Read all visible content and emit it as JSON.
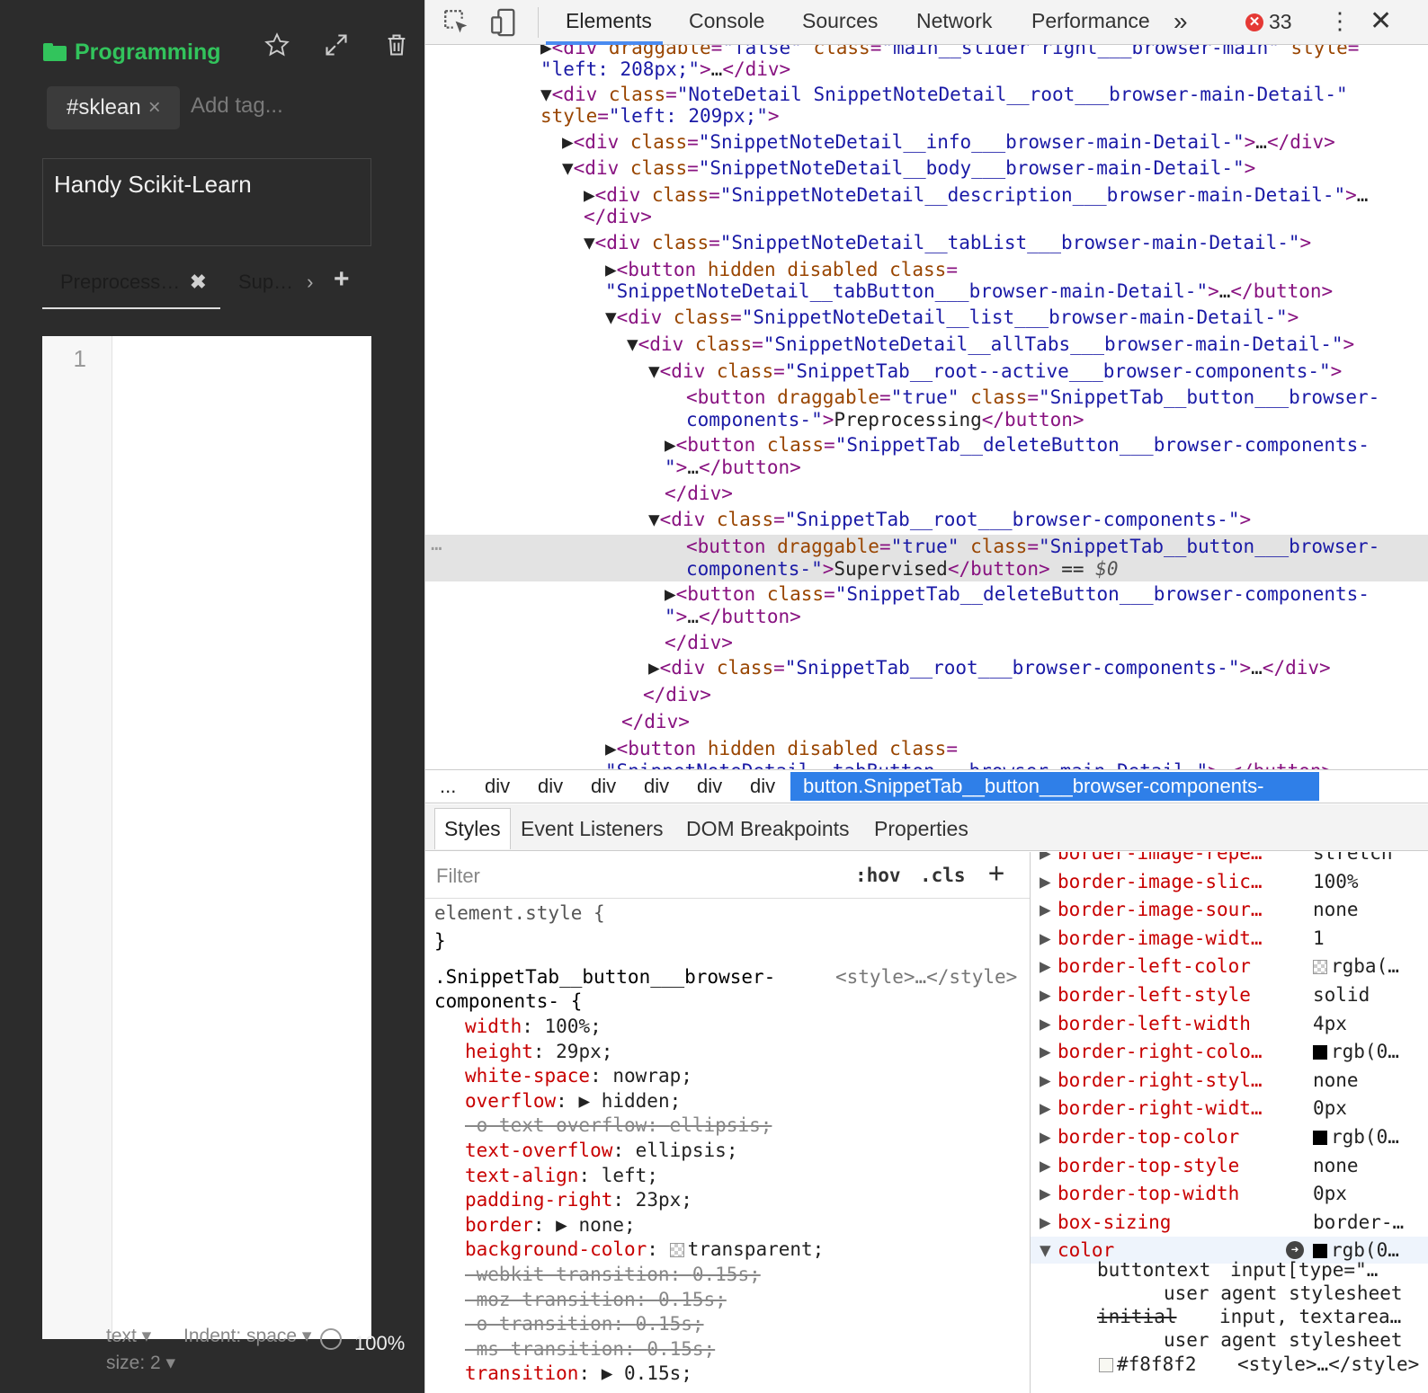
{
  "app": {
    "folder": "Programming",
    "tag": "#sklean",
    "tag_remove": "×",
    "tag_placeholder": "Add tag...",
    "title": "Handy Scikit-Learn",
    "tabs": [
      {
        "label": "Preprocessing",
        "delete": "✖"
      },
      {
        "label": "Supervised",
        "chevron": "›"
      }
    ],
    "add_tab": "+",
    "line_numbers": [
      "1"
    ],
    "status": {
      "mode": "text ▾",
      "indent": "Indent: space ▾",
      "size": "size: 2 ▾",
      "zoom": "100%"
    }
  },
  "devtools": {
    "tabs": [
      "Elements",
      "Console",
      "Sources",
      "Network",
      "Performance"
    ],
    "active_tab": "Elements",
    "more": "»",
    "error_icon": "✕",
    "error_count": "33",
    "kebab": "⋮",
    "close": "✕",
    "dom_lines": [
      {
        "parts": [
          [
            "tx",
            "▶"
          ],
          [
            "t",
            "<div "
          ],
          [
            "a",
            "draggable"
          ],
          [
            "t",
            "="
          ],
          [
            "v",
            "\"false\""
          ],
          [
            "a",
            " class"
          ],
          [
            "t",
            "="
          ],
          [
            "v",
            "\"main__slider right___browser-main\""
          ],
          [
            "a",
            " style"
          ],
          [
            "t",
            "="
          ]
        ]
      },
      {
        "parts": [
          [
            "v",
            "\"left: 208px;\""
          ],
          [
            "t",
            ">"
          ],
          [
            "tx",
            "…"
          ],
          [
            "t",
            "</div>"
          ]
        ]
      },
      {
        "parts": [
          [
            "tx",
            "▼"
          ],
          [
            "t",
            "<div "
          ],
          [
            "a",
            "class"
          ],
          [
            "t",
            "="
          ],
          [
            "v",
            "\"NoteDetail SnippetNoteDetail__root___browser-main-Detail-\""
          ]
        ]
      },
      {
        "parts": [
          [
            "a",
            "style"
          ],
          [
            "t",
            "="
          ],
          [
            "v",
            "\"left: 209px;\""
          ],
          [
            "t",
            ">"
          ]
        ]
      },
      {
        "parts": [
          [
            "tx",
            "▶"
          ],
          [
            "t",
            "<div "
          ],
          [
            "a",
            "class"
          ],
          [
            "t",
            "="
          ],
          [
            "v",
            "\"SnippetNoteDetail__info___browser-main-Detail-\""
          ],
          [
            "t",
            ">"
          ],
          [
            "tx",
            "…"
          ],
          [
            "t",
            "</div>"
          ]
        ]
      },
      {
        "parts": [
          [
            "tx",
            "▼"
          ],
          [
            "t",
            "<div "
          ],
          [
            "a",
            "class"
          ],
          [
            "t",
            "="
          ],
          [
            "v",
            "\"SnippetNoteDetail__body___browser-main-Detail-\""
          ],
          [
            "t",
            ">"
          ]
        ]
      },
      {
        "parts": [
          [
            "tx",
            "▶"
          ],
          [
            "t",
            "<div "
          ],
          [
            "a",
            "class"
          ],
          [
            "t",
            "="
          ],
          [
            "v",
            "\"SnippetNoteDetail__description___browser-main-Detail-\""
          ],
          [
            "t",
            ">"
          ],
          [
            "tx",
            "…"
          ]
        ]
      },
      {
        "parts": [
          [
            "t",
            "</div>"
          ]
        ]
      },
      {
        "parts": [
          [
            "tx",
            "▼"
          ],
          [
            "t",
            "<div "
          ],
          [
            "a",
            "class"
          ],
          [
            "t",
            "="
          ],
          [
            "v",
            "\"SnippetNoteDetail__tabList___browser-main-Detail-\""
          ],
          [
            "t",
            ">"
          ]
        ]
      },
      {
        "parts": [
          [
            "tx",
            "▶"
          ],
          [
            "t",
            "<button "
          ],
          [
            "a",
            "hidden disabled class"
          ],
          [
            "t",
            "="
          ]
        ]
      },
      {
        "parts": [
          [
            "v",
            "\"SnippetNoteDetail__tabButton___browser-main-Detail-\""
          ],
          [
            "t",
            ">"
          ],
          [
            "tx",
            "…"
          ],
          [
            "t",
            "</button>"
          ]
        ]
      },
      {
        "parts": [
          [
            "tx",
            "▼"
          ],
          [
            "t",
            "<div "
          ],
          [
            "a",
            "class"
          ],
          [
            "t",
            "="
          ],
          [
            "v",
            "\"SnippetNoteDetail__list___browser-main-Detail-\""
          ],
          [
            "t",
            ">"
          ]
        ]
      },
      {
        "parts": [
          [
            "tx",
            "▼"
          ],
          [
            "t",
            "<div "
          ],
          [
            "a",
            "class"
          ],
          [
            "t",
            "="
          ],
          [
            "v",
            "\"SnippetNoteDetail__allTabs___browser-main-Detail-\""
          ],
          [
            "t",
            ">"
          ]
        ]
      },
      {
        "parts": [
          [
            "tx",
            "▼"
          ],
          [
            "t",
            "<div "
          ],
          [
            "a",
            "class"
          ],
          [
            "t",
            "="
          ],
          [
            "v",
            "\"SnippetTab__root--active___browser-components-\""
          ],
          [
            "t",
            ">"
          ]
        ]
      },
      {
        "parts": [
          [
            "t",
            "<button "
          ],
          [
            "a",
            "draggable"
          ],
          [
            "t",
            "="
          ],
          [
            "v",
            "\"true\""
          ],
          [
            "a",
            "  class"
          ],
          [
            "t",
            "="
          ],
          [
            "v",
            "\"SnippetTab__button___browser-"
          ]
        ]
      },
      {
        "parts": [
          [
            "v",
            "components-\""
          ],
          [
            "t",
            ">"
          ],
          [
            "tx",
            "Preprocessing"
          ],
          [
            "t",
            "</button>"
          ]
        ]
      },
      {
        "parts": [
          [
            "tx",
            "▶"
          ],
          [
            "t",
            "<button "
          ],
          [
            "a",
            "class"
          ],
          [
            "t",
            "="
          ],
          [
            "v",
            "\"SnippetTab__deleteButton___browser-components-"
          ]
        ]
      },
      {
        "parts": [
          [
            "v",
            "\""
          ],
          [
            "t",
            ">"
          ],
          [
            "tx",
            "…"
          ],
          [
            "t",
            "</button>"
          ]
        ]
      },
      {
        "parts": [
          [
            "t",
            "</div>"
          ]
        ]
      },
      {
        "parts": [
          [
            "tx",
            "▼"
          ],
          [
            "t",
            "<div "
          ],
          [
            "a",
            "class"
          ],
          [
            "t",
            "="
          ],
          [
            "v",
            "\"SnippetTab__root___browser-components-\""
          ],
          [
            "t",
            ">"
          ]
        ]
      },
      {
        "parts": [
          [
            "t",
            "<button "
          ],
          [
            "a",
            "draggable"
          ],
          [
            "t",
            "="
          ],
          [
            "v",
            "\"true\""
          ],
          [
            "a",
            "  class"
          ],
          [
            "t",
            "="
          ],
          [
            "v",
            "\"SnippetTab__button___browser-"
          ]
        ]
      },
      {
        "parts": [
          [
            "v",
            "components-\""
          ],
          [
            "t",
            ">"
          ],
          [
            "tx",
            "Supervised"
          ],
          [
            "t",
            "</button>"
          ],
          [
            "tx",
            " == "
          ],
          [
            "s0",
            "$0"
          ]
        ]
      },
      {
        "parts": [
          [
            "tx",
            "▶"
          ],
          [
            "t",
            "<button "
          ],
          [
            "a",
            "class"
          ],
          [
            "t",
            "="
          ],
          [
            "v",
            "\"SnippetTab__deleteButton___browser-components-"
          ]
        ]
      },
      {
        "parts": [
          [
            "v",
            "\""
          ],
          [
            "t",
            ">"
          ],
          [
            "tx",
            "…"
          ],
          [
            "t",
            "</button>"
          ]
        ]
      },
      {
        "parts": [
          [
            "t",
            "</div>"
          ]
        ]
      },
      {
        "parts": [
          [
            "tx",
            "▶"
          ],
          [
            "t",
            "<div "
          ],
          [
            "a",
            "class"
          ],
          [
            "t",
            "="
          ],
          [
            "v",
            "\"SnippetTab__root___browser-components-\""
          ],
          [
            "t",
            ">"
          ],
          [
            "tx",
            "…"
          ],
          [
            "t",
            "</div>"
          ]
        ]
      },
      {
        "parts": [
          [
            "t",
            "</div>"
          ]
        ]
      },
      {
        "parts": [
          [
            "t",
            "</div>"
          ]
        ]
      },
      {
        "parts": [
          [
            "tx",
            "▶"
          ],
          [
            "t",
            "<button "
          ],
          [
            "a",
            "hidden disabled class"
          ],
          [
            "t",
            "="
          ]
        ]
      },
      {
        "parts": [
          [
            "v",
            "\"SnippetNoteDetail__tabButton___browser-main-Detail-\""
          ],
          [
            "t",
            ">"
          ],
          [
            "tx",
            "…"
          ],
          [
            "t",
            "</button>"
          ]
        ]
      }
    ],
    "dom_dots": "⋯",
    "breadcrumbs": [
      "...",
      "div",
      "div",
      "div",
      "div",
      "div",
      "div"
    ],
    "breadcrumb_selected": "button.SnippetTab__button___browser-components-",
    "subtabs": [
      "Styles",
      "Event Listeners",
      "DOM Breakpoints",
      "Properties"
    ],
    "filter_placeholder": "Filter",
    "hov": ":hov",
    "cls": ".cls",
    "new_rule": "+",
    "element_style_open": "element.style {",
    "element_style_close": "}",
    "rule_selector_1": ".SnippetTab__button___browser-",
    "rule_selector_2": "components- {",
    "rule_source": "<style>…</style>",
    "declarations": [
      {
        "prop": "width",
        "val": "100%;",
        "struck": false
      },
      {
        "prop": "height",
        "val": "29px;",
        "struck": false
      },
      {
        "prop": "white-space",
        "val": "nowrap;",
        "struck": false
      },
      {
        "prop": "overflow",
        "val": "▶ hidden;",
        "struck": false
      },
      {
        "prop": "-o-text-overflow",
        "val": "ellipsis;",
        "struck": true
      },
      {
        "prop": "text-overflow",
        "val": "ellipsis;",
        "struck": false
      },
      {
        "prop": "text-align",
        "val": "left;",
        "struck": false
      },
      {
        "prop": "padding-right",
        "val": "23px;",
        "struck": false
      },
      {
        "prop": "border",
        "val": "▶ none;",
        "struck": false
      },
      {
        "prop": "background-color",
        "val": "transparent;",
        "struck": false,
        "swatch": "checker"
      },
      {
        "prop": "-webkit-transition",
        "val": "0.15s;",
        "struck": true
      },
      {
        "prop": "-moz-transition",
        "val": "0.15s;",
        "struck": true
      },
      {
        "prop": "-o-transition",
        "val": "0.15s;",
        "struck": true
      },
      {
        "prop": "-ms-transition",
        "val": "0.15s;",
        "struck": true
      },
      {
        "prop": "transition",
        "val": "▶ 0.15s;",
        "struck": false
      }
    ],
    "computed": [
      {
        "prop": "border-image-repe…",
        "val": "stretch",
        "tri": "▶"
      },
      {
        "prop": "border-image-slic…",
        "val": "100%",
        "tri": "▶"
      },
      {
        "prop": "border-image-sour…",
        "val": "none",
        "tri": "▶"
      },
      {
        "prop": "border-image-widt…",
        "val": "1",
        "tri": "▶"
      },
      {
        "prop": "border-left-color",
        "val": "rgba(…",
        "tri": "▶",
        "swatch": "checker"
      },
      {
        "prop": "border-left-style",
        "val": "solid",
        "tri": "▶"
      },
      {
        "prop": "border-left-width",
        "val": "4px",
        "tri": "▶"
      },
      {
        "prop": "border-right-colo…",
        "val": "rgb(0…",
        "tri": "▶",
        "swatch": "blk"
      },
      {
        "prop": "border-right-styl…",
        "val": "none",
        "tri": "▶"
      },
      {
        "prop": "border-right-widt…",
        "val": "0px",
        "tri": "▶"
      },
      {
        "prop": "border-top-color",
        "val": "rgb(0…",
        "tri": "▶",
        "swatch": "blk"
      },
      {
        "prop": "border-top-style",
        "val": "none",
        "tri": "▶"
      },
      {
        "prop": "border-top-width",
        "val": "0px",
        "tri": "▶"
      },
      {
        "prop": "box-sizing",
        "val": "border-…",
        "tri": "▶"
      },
      {
        "prop": "color",
        "val": "rgb(0…",
        "tri": "▼",
        "swatch": "blk",
        "goto": "➜"
      }
    ],
    "color_sub": [
      {
        "left": "buttontext",
        "right": "input[type=\"…"
      },
      {
        "left": "",
        "right": "user agent stylesheet"
      },
      {
        "left": "initial",
        "right": "input, textarea…",
        "struck": true
      },
      {
        "left": "",
        "right": "user agent stylesheet"
      },
      {
        "left": "#f8f8f2",
        "right": "<style>…</style>",
        "swatch": "f8"
      }
    ]
  }
}
